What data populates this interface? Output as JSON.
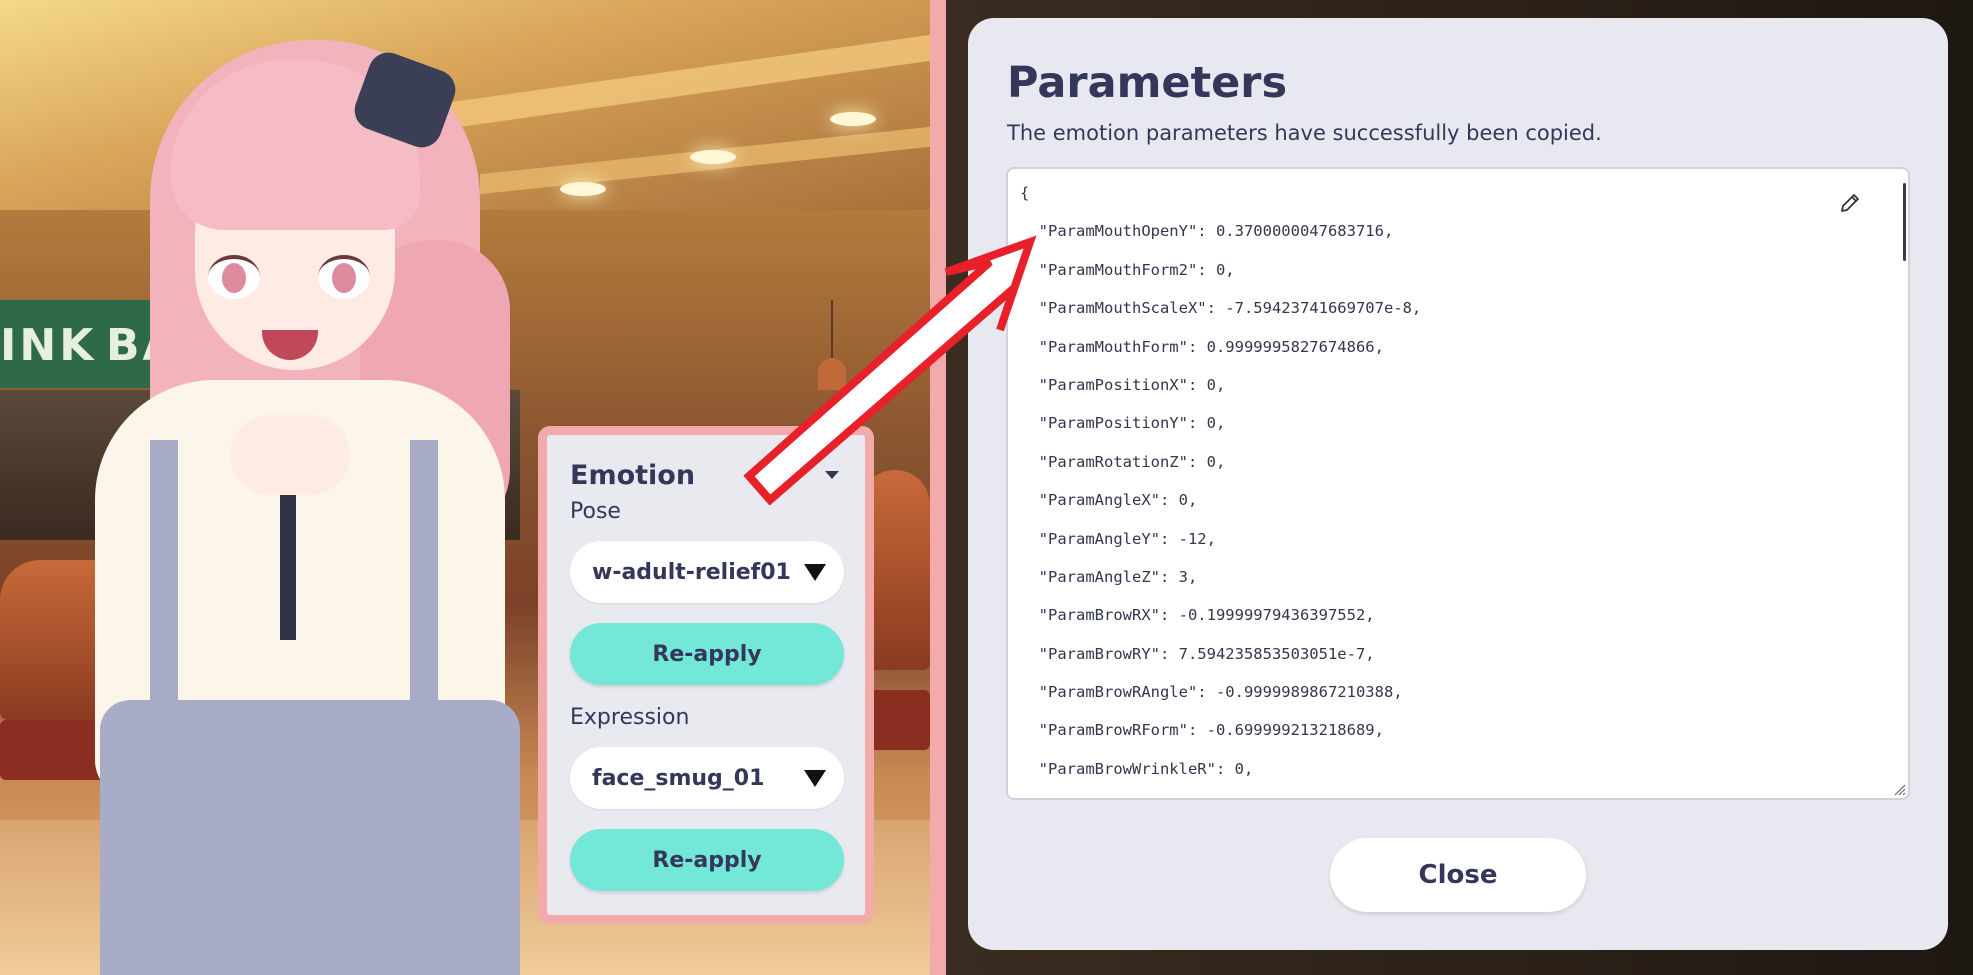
{
  "emotion_panel": {
    "title": "Emotion",
    "pose_label": "Pose",
    "pose_value": "w-adult-relief01",
    "pose_reapply": "Re-apply",
    "expression_label": "Expression",
    "expression_value": "face_smug_01",
    "expression_reapply": "Re-apply"
  },
  "scene": {
    "sign_text_1": "INK",
    "sign_text_2": "BA"
  },
  "modal": {
    "title": "Parameters",
    "subtitle": "The emotion parameters have successfully been copied.",
    "close_label": "Close",
    "json_lines": [
      "{",
      "  \"ParamMouthOpenY\": 0.3700000047683716,",
      "  \"ParamMouthForm2\": 0,",
      "  \"ParamMouthScaleX\": -7.59423741669707e-8,",
      "  \"ParamMouthForm\": 0.9999995827674866,",
      "  \"ParamPositionX\": 0,",
      "  \"ParamPositionY\": 0,",
      "  \"ParamRotationZ\": 0,",
      "  \"ParamAngleX\": 0,",
      "  \"ParamAngleY\": -12,",
      "  \"ParamAngleZ\": 3,",
      "  \"ParamBrowRX\": -0.19999979436397552,",
      "  \"ParamBrowRY\": 7.594235853503051e-7,",
      "  \"ParamBrowRAngle\": -0.9999989867210388,",
      "  \"ParamBrowRForm\": -0.699999213218689,",
      "  \"ParamBrowWrinkleR\": 0,"
    ]
  },
  "colors": {
    "accent_pink": "#f2aaaa",
    "button_teal": "#74e8d8",
    "text_navy": "#35375a",
    "arrow_red": "#e8202a"
  },
  "icons": {
    "edit": "pencil-icon",
    "collapse": "caret-down-icon",
    "select": "triangle-down-icon"
  }
}
